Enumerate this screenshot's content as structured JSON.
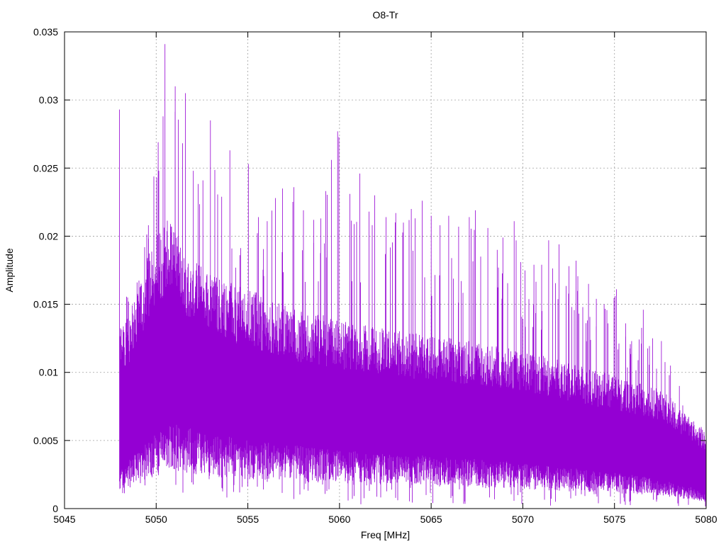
{
  "chart_data": {
    "type": "line",
    "title": "O8-Tr",
    "xlabel": "Freq [MHz]",
    "ylabel": "Amplitude",
    "xlim": [
      5045,
      5080
    ],
    "ylim": [
      0,
      0.035
    ],
    "x_ticks": [
      5045,
      5050,
      5055,
      5060,
      5065,
      5070,
      5075,
      5080
    ],
    "x_tick_labels": [
      "5045",
      "5050",
      "5055",
      "5060",
      "5065",
      "5070",
      "5075",
      "5080"
    ],
    "y_ticks": [
      0,
      0.005,
      0.01,
      0.015,
      0.02,
      0.025,
      0.03,
      0.035
    ],
    "y_tick_labels": [
      "0",
      "0.005",
      "0.01",
      "0.015",
      "0.02",
      "0.025",
      "0.03",
      "0.035"
    ],
    "grid": true,
    "legend": "none",
    "series": [
      {
        "color": "#9400d3",
        "x": [
          5048.0,
          5048.5,
          5049.0,
          5049.5,
          5050.0,
          5050.5,
          5051.0,
          5051.5,
          5052.0,
          5052.5,
          5053.0,
          5053.5,
          5054.0,
          5054.5,
          5055.0,
          5055.5,
          5056.0,
          5056.5,
          5057.0,
          5057.5,
          5058.0,
          5058.5,
          5059.0,
          5059.5,
          5060.0,
          5060.5,
          5061.0,
          5061.5,
          5062.0,
          5062.5,
          5063.0,
          5063.5,
          5064.0,
          5064.5,
          5065.0,
          5065.5,
          5066.0,
          5066.5,
          5067.0,
          5067.5,
          5068.0,
          5068.5,
          5069.0,
          5069.5,
          5070.0,
          5070.5,
          5071.0,
          5071.5,
          5072.0,
          5072.5,
          5073.0,
          5073.5,
          5074.0,
          5074.5,
          5075.0,
          5075.5,
          5076.0,
          5076.5,
          5077.0,
          5077.5,
          5078.0,
          5078.5,
          5079.0,
          5079.5,
          5080.0
        ],
        "max": [
          0.0293,
          0.0152,
          0.0166,
          0.0208,
          0.0269,
          0.0341,
          0.031,
          0.0305,
          0.0248,
          0.0241,
          0.0285,
          0.0229,
          0.0263,
          0.0186,
          0.0253,
          0.0214,
          0.0211,
          0.0228,
          0.0235,
          0.0236,
          0.0219,
          0.0212,
          0.0213,
          0.0256,
          0.0277,
          0.0231,
          0.0246,
          0.0218,
          0.023,
          0.0214,
          0.0217,
          0.021,
          0.022,
          0.0226,
          0.0215,
          0.0208,
          0.0215,
          0.0207,
          0.0214,
          0.0219,
          0.0206,
          0.019,
          0.0199,
          0.0211,
          0.0181,
          0.0179,
          0.0179,
          0.0197,
          0.0194,
          0.0178,
          0.0182,
          0.0165,
          0.0154,
          0.015,
          0.0161,
          0.0136,
          0.0123,
          0.0146,
          0.0125,
          0.0123,
          0.0105,
          0.009,
          0.0063,
          0.0052,
          0.005
        ],
        "upper": [
          0.012,
          0.0125,
          0.014,
          0.016,
          0.0175,
          0.0185,
          0.018,
          0.017,
          0.016,
          0.0155,
          0.015,
          0.0148,
          0.0145,
          0.0142,
          0.014,
          0.0138,
          0.0135,
          0.0133,
          0.013,
          0.0128,
          0.0126,
          0.0125,
          0.0124,
          0.0122,
          0.012,
          0.0119,
          0.0118,
          0.0117,
          0.0116,
          0.0115,
          0.0114,
          0.0113,
          0.0112,
          0.0112,
          0.0111,
          0.011,
          0.0109,
          0.0108,
          0.0107,
          0.0106,
          0.0105,
          0.0104,
          0.0103,
          0.0102,
          0.01,
          0.0099,
          0.0098,
          0.0096,
          0.0095,
          0.0093,
          0.0092,
          0.009,
          0.0088,
          0.0087,
          0.0085,
          0.0083,
          0.0082,
          0.008,
          0.0078,
          0.0076,
          0.0072,
          0.0066,
          0.006,
          0.0055,
          0.005
        ],
        "lower": [
          0.002,
          0.0025,
          0.003,
          0.0035,
          0.004,
          0.0042,
          0.0045,
          0.0044,
          0.0042,
          0.004,
          0.004,
          0.0038,
          0.0038,
          0.0036,
          0.0036,
          0.0035,
          0.0035,
          0.0034,
          0.0034,
          0.0033,
          0.0033,
          0.0032,
          0.0032,
          0.0031,
          0.0031,
          0.003,
          0.003,
          0.003,
          0.0029,
          0.0029,
          0.0029,
          0.0028,
          0.0028,
          0.0028,
          0.0027,
          0.0027,
          0.0027,
          0.0026,
          0.0026,
          0.0026,
          0.0025,
          0.0025,
          0.0025,
          0.0024,
          0.0024,
          0.0023,
          0.0023,
          0.0022,
          0.0022,
          0.0021,
          0.0021,
          0.002,
          0.002,
          0.0019,
          0.0019,
          0.0018,
          0.0018,
          0.0017,
          0.0016,
          0.0015,
          0.0014,
          0.0013,
          0.0012,
          0.001,
          0.0008
        ],
        "min": [
          0.0002,
          0.0003,
          0.0004,
          0.0006,
          0.0008,
          0.0009,
          0.0009,
          0.0009,
          0.0008,
          0.0008,
          0.0007,
          0.0007,
          0.0007,
          0.0006,
          0.0006,
          0.0006,
          0.0005,
          0.0005,
          0.0005,
          0.0005,
          0.0004,
          0.0004,
          0.0004,
          0.0003,
          0.0003,
          0.0003,
          0.0003,
          0.0003,
          0.0003,
          0.0003,
          0.0003,
          0.0003,
          0.0003,
          0.0003,
          0.0003,
          0.0003,
          0.0003,
          0.0003,
          0.0003,
          0.0003,
          0.0002,
          0.0002,
          0.0002,
          0.0002,
          0.0002,
          0.0002,
          0.0002,
          0.0002,
          0.0002,
          0.0002,
          0.0002,
          0.0002,
          0.0002,
          0.0002,
          0.0002,
          0.0002,
          0.0002,
          0.0001,
          0.0001,
          0.0001,
          0.0001,
          0.0001,
          0.0001,
          0.0001,
          0.0001
        ]
      }
    ]
  }
}
